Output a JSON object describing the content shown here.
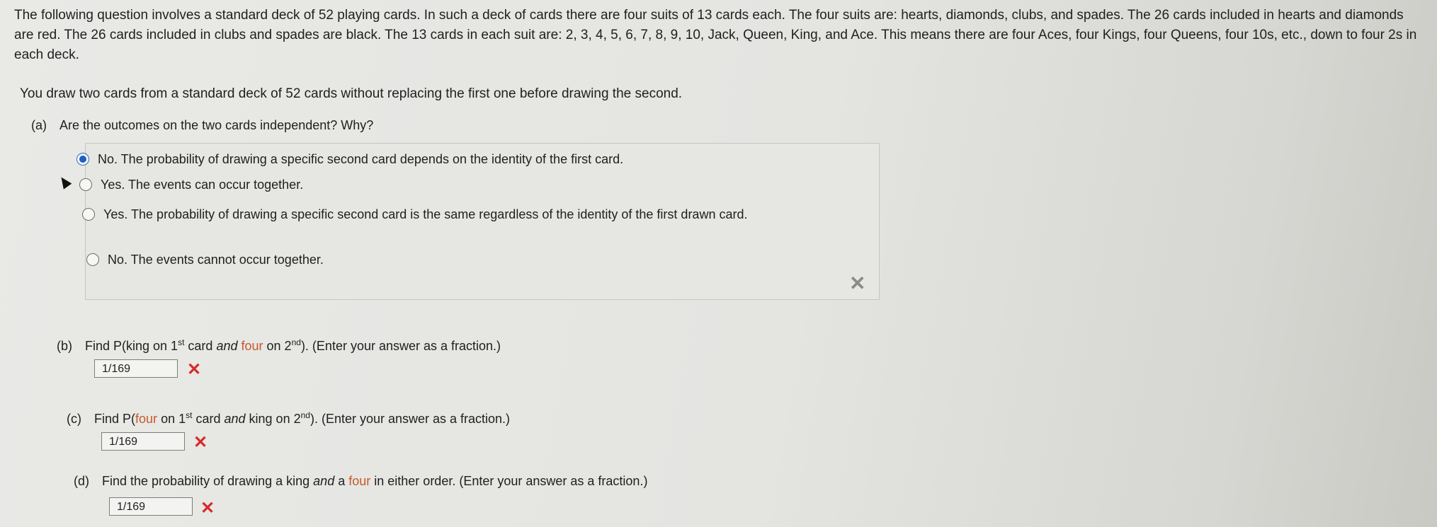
{
  "intro": {
    "text": "The following question involves a standard deck of 52 playing cards. In such a deck of cards there are four suits of 13 cards each. The four suits are: hearts, diamonds, clubs, and spades. The 26 cards included in hearts and diamonds are red. The 26 cards included in clubs and spades are black. The 13 cards in each suit are: 2, 3, 4, 5, 6, 7, 8, 9, 10, Jack, Queen, King, and Ace. This means there are four Aces, four Kings, four Queens, four 10s, etc., down to four 2s in each deck."
  },
  "draw_text": "You draw two cards from a standard deck of 52 cards without replacing the first one before drawing the second.",
  "part_a": {
    "letter": "(a)",
    "question": "Are the outcomes on the two cards independent? Why?",
    "options": [
      {
        "label": "No. The probability of drawing a specific second card depends on the identity of the first card.",
        "selected": true
      },
      {
        "label": "Yes. The events can occur together.",
        "selected": false
      },
      {
        "label": "Yes. The probability of drawing a specific second card is the same regardless of the identity of the first drawn card.",
        "selected": false
      },
      {
        "label": "No. The events cannot occur together.",
        "selected": false
      }
    ],
    "status_mark": "✕"
  },
  "part_b": {
    "letter": "(b)",
    "prefix": "Find P(king on 1",
    "sup1": "st",
    "mid1": " card ",
    "and": "and",
    "four": " four",
    "mid2": " on 2",
    "sup2": "nd",
    "suffix": "). (Enter your answer as a fraction.)",
    "answer": "1/169",
    "status_mark": "✕"
  },
  "part_c": {
    "letter": "(c)",
    "prefix": "Find P(",
    "four": "four",
    "mid1": " on 1",
    "sup1": "st",
    "mid2": " card ",
    "and": "and",
    "mid3": " king on 2",
    "sup2": "nd",
    "suffix": "). (Enter your answer as a fraction.)",
    "answer": "1/169",
    "status_mark": "✕"
  },
  "part_d": {
    "letter": "(d)",
    "prefix": "Find the probability of drawing a king ",
    "and": "and",
    "mid": " a ",
    "four": "four",
    "suffix": " in either order. (Enter your answer as a fraction.)",
    "answer": "1/169",
    "status_mark": "✕"
  },
  "colors": {
    "accent_radio": "#1f5fbf",
    "error_mark": "#d62a2a",
    "highlight_word": "#c45a2a"
  }
}
